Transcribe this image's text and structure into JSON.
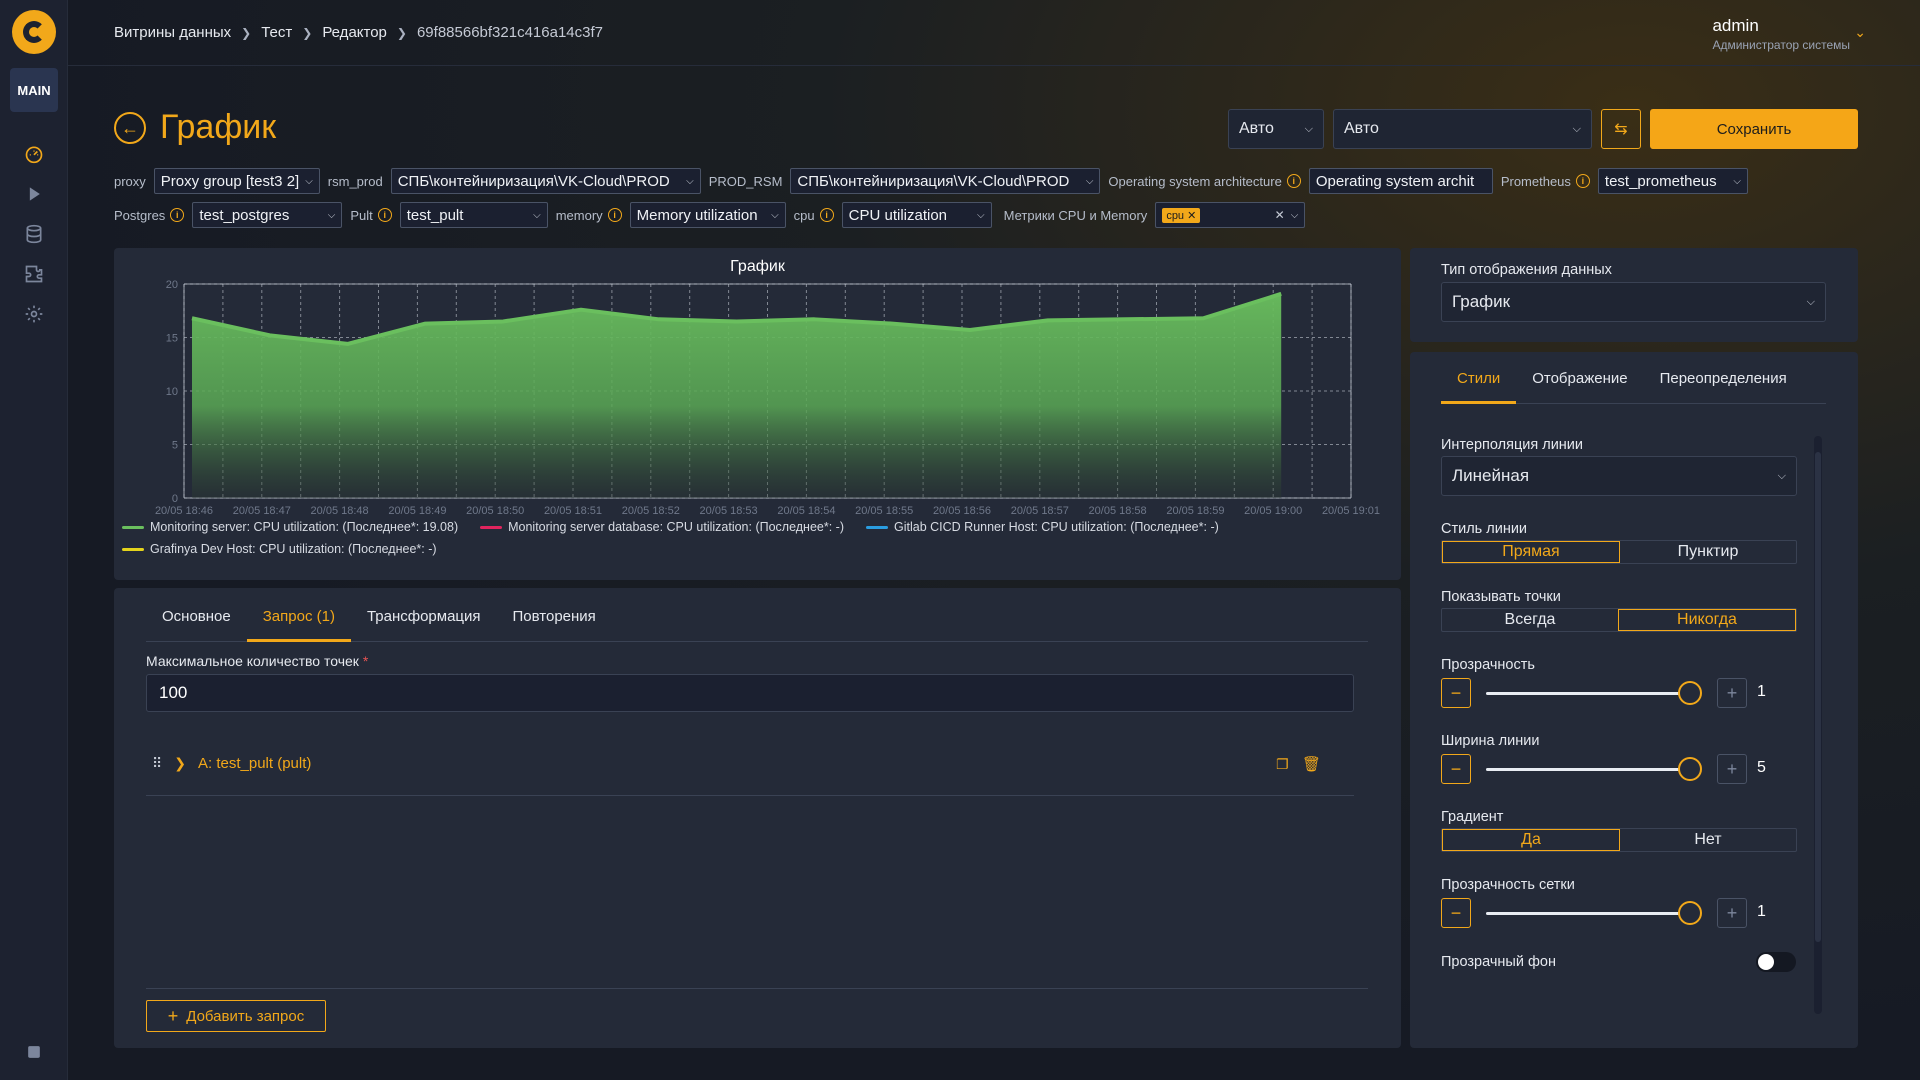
{
  "sidebar": {
    "main_label": "MAIN",
    "icons": [
      "dashboard-icon",
      "play-icon",
      "database-icon",
      "plugin-icon",
      "gear-icon"
    ],
    "bottom_icon": "collapse-icon"
  },
  "header": {
    "breadcrumb": [
      "Витрины данных",
      "Тест",
      "Редактор",
      "69f88566bf321c416a14c3f7"
    ],
    "user_name": "admin",
    "user_role": "Администратор системы"
  },
  "page": {
    "title": "График",
    "refresh_select_1": "Авто",
    "refresh_select_2": "Авто",
    "save_label": "Сохранить"
  },
  "variables": {
    "row1": [
      {
        "label": "proxy",
        "value": "Proxy group [test3 2]",
        "info": false
      },
      {
        "label": "rsm_prod",
        "value": "СПБ\\контейниризация\\VK-Cloud\\PROD",
        "info": false
      },
      {
        "label": "PROD_RSM",
        "value": "СПБ\\контейниризация\\VK-Cloud\\PROD",
        "info": false
      },
      {
        "label": "Operating system architecture",
        "value": "Operating system archit",
        "info": true
      },
      {
        "label": "Prometheus",
        "value": "test_prometheus",
        "info": true
      }
    ],
    "row2": [
      {
        "label": "Postgres",
        "value": "test_postgres",
        "info": true
      },
      {
        "label": "Pult",
        "value": "test_pult",
        "info": true
      },
      {
        "label": "memory",
        "value": "Memory utilization",
        "info": true
      },
      {
        "label": "cpu",
        "value": "CPU utilization",
        "info": true
      }
    ],
    "metrics_label": "Метрики CPU и Memory",
    "metrics_tag": "cpu"
  },
  "chart_data": {
    "type": "area",
    "title": "График",
    "x": [
      "20/05 18:46",
      "20/05 18:47",
      "20/05 18:48",
      "20/05 18:49",
      "20/05 18:50",
      "20/05 18:51",
      "20/05 18:52",
      "20/05 18:53",
      "20/05 18:54",
      "20/05 18:55",
      "20/05 18:56",
      "20/05 18:57",
      "20/05 18:58",
      "20/05 18:59",
      "20/05 19:00",
      "20/05 19:01"
    ],
    "yticks": [
      0,
      5,
      10,
      15,
      20
    ],
    "ylim": [
      0,
      20
    ],
    "series": [
      {
        "name": "Monitoring server: CPU utilization: (Последнее*: 19.08)",
        "color": "#6abf5e",
        "values": [
          16.8,
          15.2,
          14.4,
          16.3,
          16.5,
          17.6,
          16.7,
          16.5,
          16.7,
          16.3,
          15.7,
          16.6,
          16.7,
          16.8,
          19.08,
          null
        ]
      },
      {
        "name": "Monitoring server database: CPU utilization: (Последнее*: -)",
        "color": "#e0245e",
        "values": []
      },
      {
        "name": "Gitlab CICD Runner Host: CPU utilization: (Последнее*: -)",
        "color": "#2a9de0",
        "values": []
      },
      {
        "name": "Grafinya Dev Host: CPU utilization: (Последнее*: -)",
        "color": "#e4d31c",
        "values": []
      }
    ],
    "grid": true,
    "legend": "bottom-left"
  },
  "editor": {
    "tabs": [
      "Основное",
      "Запрос (1)",
      "Трансформация",
      "Повторения"
    ],
    "active_tab": 1,
    "max_points_label": "Максимальное количество точек",
    "max_points_value": "100",
    "query_name": "A: test_pult (pult)",
    "add_query_label": "Добавить запрос"
  },
  "display_type": {
    "label": "Тип отображения данных",
    "value": "График"
  },
  "styles": {
    "tabs": [
      "Стили",
      "Отображение",
      "Переопределения"
    ],
    "interpolation_label": "Интерполяция линии",
    "interpolation_value": "Линейная",
    "line_style_label": "Стиль линии",
    "line_style_options": [
      "Прямая",
      "Пунктир"
    ],
    "points_label": "Показывать точки",
    "points_options": [
      "Всегда",
      "Никогда"
    ],
    "opacity_label": "Прозрачность",
    "opacity_value": "1",
    "line_width_label": "Ширина линии",
    "line_width_value": "5",
    "gradient_label": "Градиент",
    "gradient_options": [
      "Да",
      "Нет"
    ],
    "grid_opacity_label": "Прозрачность сетки",
    "grid_opacity_value": "1",
    "transparent_bg_label": "Прозрачный фон"
  }
}
